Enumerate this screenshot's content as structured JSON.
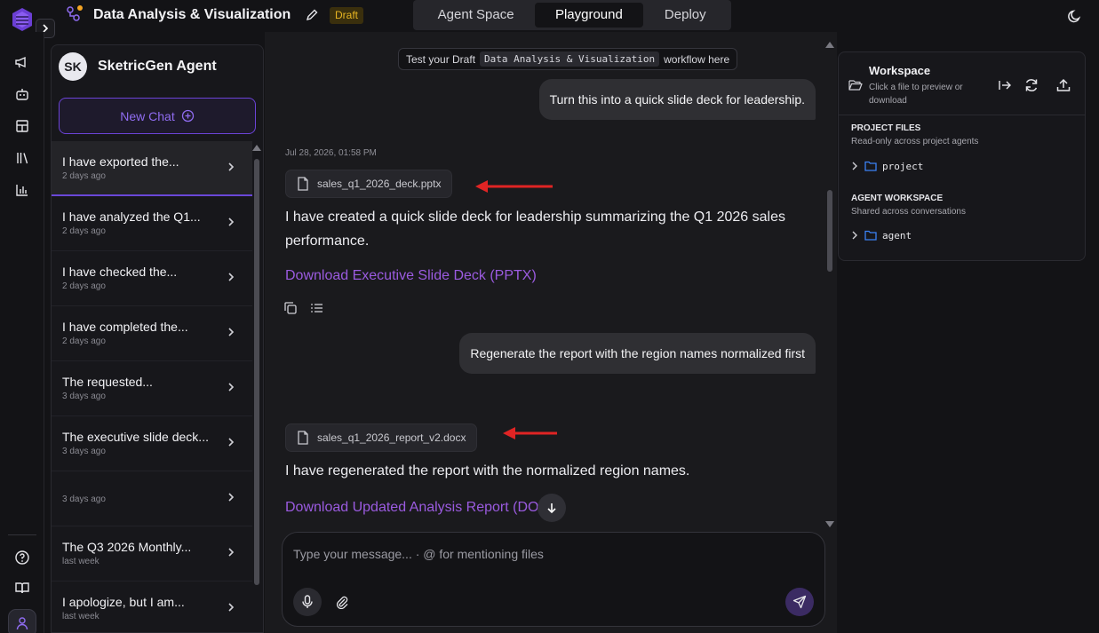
{
  "header": {
    "app_title": "Data Analysis & Visualization",
    "status_badge": "Draft",
    "tabs": [
      {
        "label": "Agent Space",
        "active": false
      },
      {
        "label": "Playground",
        "active": true
      },
      {
        "label": "Deploy",
        "active": false
      }
    ]
  },
  "rail": {
    "icons": [
      "megaphone-icon",
      "bot-icon",
      "layout-icon",
      "library-icon",
      "chart-icon",
      "help-icon",
      "book-icon",
      "user-icon"
    ]
  },
  "chat_list": {
    "agent_initials": "SK",
    "agent_name": "SketricGen Agent",
    "new_chat_label": "New Chat",
    "items": [
      {
        "title": "I have exported the...",
        "time": "2 days ago",
        "active": true
      },
      {
        "title": "I have analyzed the Q1...",
        "time": "2 days ago",
        "active": false
      },
      {
        "title": "I have checked the...",
        "time": "2 days ago",
        "active": false
      },
      {
        "title": "I have completed the...",
        "time": "2 days ago",
        "active": false
      },
      {
        "title": "The requested...",
        "time": "3 days ago",
        "active": false
      },
      {
        "title": "The executive slide deck...",
        "time": "3 days ago",
        "active": false
      },
      {
        "title": "",
        "time": "3 days ago",
        "active": false
      },
      {
        "title": "The Q3 2026 Monthly...",
        "time": "last week",
        "active": false
      },
      {
        "title": "I apologize, but I am...",
        "time": "last week",
        "active": false
      }
    ]
  },
  "chat": {
    "draft_notice": {
      "prefix": "Test your Draft",
      "workflow": "Data Analysis & Visualization",
      "suffix": "workflow here"
    },
    "messages": {
      "user_1": "Turn this into a quick slide deck for leadership.",
      "timestamp_1": "Jul 28, 2026, 01:58 PM",
      "file_1": "sales_q1_2026_deck.pptx",
      "bot_1": "I have created a quick slide deck for leadership summarizing the Q1 2026 sales performance.",
      "link_1": "Download Executive Slide Deck (PPTX)",
      "user_2": "Regenerate the report with the region names normalized first",
      "file_2": "sales_q1_2026_report_v2.docx",
      "bot_2": "I have regenerated the report with the normalized region names.",
      "link_2": "Download Updated Analysis Report (DOCX)"
    },
    "composer_placeholder": "Type your message... · @ for mentioning files"
  },
  "workspace": {
    "title": "Workspace",
    "subtitle": "Click a file to preview or download",
    "sections": [
      {
        "title": "PROJECT FILES",
        "subtitle": "Read-only across project agents",
        "folder": "project"
      },
      {
        "title": "AGENT WORKSPACE",
        "subtitle": "Shared across conversations",
        "folder": "agent"
      }
    ]
  },
  "colors": {
    "accent": "#8f6cf0",
    "link": "#9b5be0",
    "draft_badge": "#e6b422",
    "annotation_arrow": "#e02424",
    "background": "#1a1a1d"
  }
}
